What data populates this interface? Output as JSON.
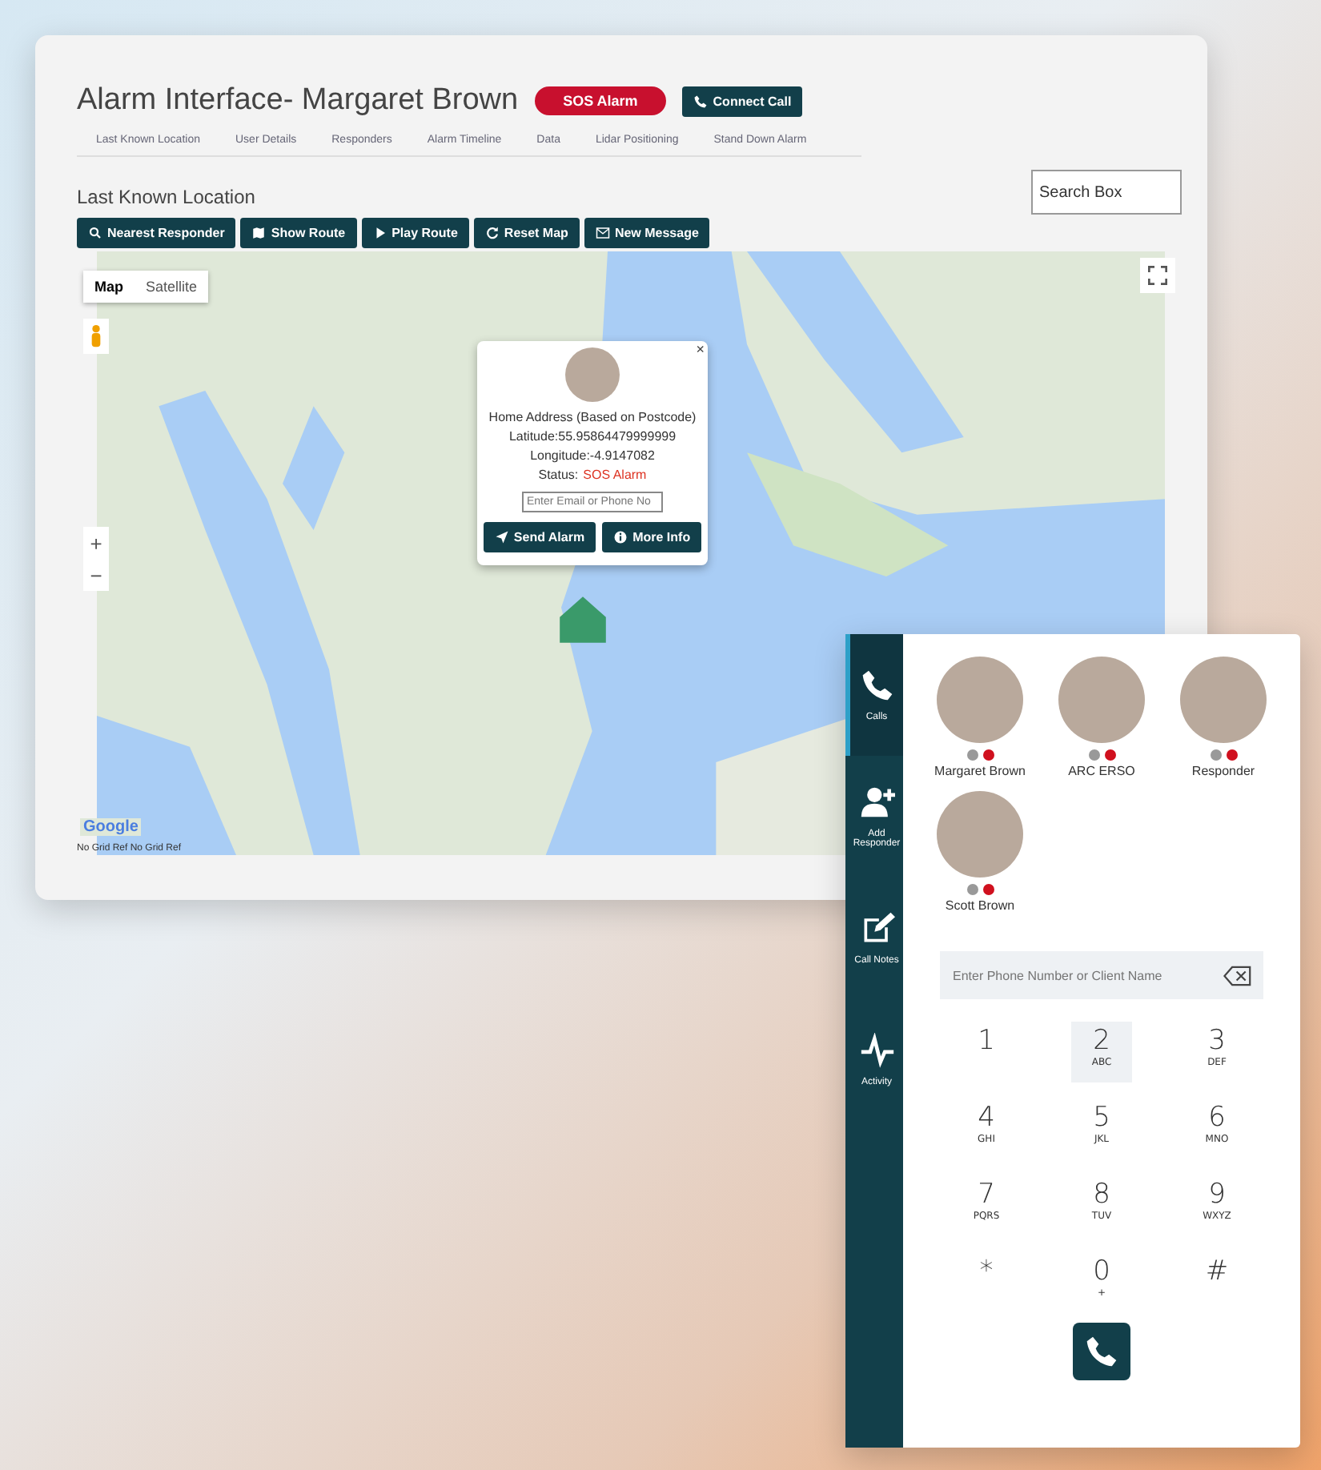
{
  "alarm_window": {
    "title": "Alarm Interface- Margaret Brown",
    "status_badge": "SOS Alarm",
    "connect_button": "Connect Call",
    "tabs": [
      {
        "label": "Last Known Location"
      },
      {
        "label": "User Details"
      },
      {
        "label": "Responders"
      },
      {
        "label": "Alarm Timeline"
      },
      {
        "label": "Data"
      },
      {
        "label": "Lidar Positioning"
      },
      {
        "label": "Stand Down Alarm"
      }
    ],
    "section_title": "Last Known Location",
    "search": {
      "placeholder": "Search Box"
    },
    "toolbar": [
      {
        "label": "Nearest Responder",
        "kind": "search"
      },
      {
        "label": "Show Route",
        "kind": "map"
      },
      {
        "label": "Play Route",
        "kind": "play"
      },
      {
        "label": "Reset Map",
        "kind": "refresh"
      },
      {
        "label": "New Message",
        "kind": "message"
      }
    ],
    "map": {
      "map_types": [
        {
          "label": "Map",
          "selected": true
        },
        {
          "label": "Satellite",
          "selected": false
        }
      ],
      "zoom_in": "+",
      "zoom_out": "−",
      "popup": {
        "close": "×",
        "address": "Home Address (Based on Postcode)",
        "latitude": "Latitude:55.95864479999999",
        "longitude": "Longitude:-4.9147082",
        "status_label": "Status:",
        "status_value": "SOS Alarm",
        "contact": {
          "placeholder": "Enter Email or Phone No"
        },
        "buttons": [
          {
            "label": "Send Alarm",
            "kind": "send"
          },
          {
            "label": "More Info",
            "kind": "info"
          }
        ]
      },
      "attribution": "Google",
      "grid_ref": "No Grid Ref No Grid Ref"
    }
  },
  "dialer": {
    "nav": [
      {
        "label": "Calls",
        "kind": "phone",
        "selected": true
      },
      {
        "label": "Add Responder",
        "kind": "add-person",
        "selected": false
      },
      {
        "label": "Call Notes",
        "kind": "edit",
        "selected": false
      },
      {
        "label": "Activity",
        "kind": "pulse",
        "selected": false
      }
    ],
    "contacts": [
      {
        "name": "Margaret Brown"
      },
      {
        "name": "ARC ERSO"
      },
      {
        "name": "Responder"
      },
      {
        "name": "Scott Brown"
      }
    ],
    "phone_field": {
      "placeholder": "Enter Phone Number or Client Name"
    },
    "keypad": [
      {
        "digit": "1",
        "selected": false
      },
      {
        "digit": "2",
        "letters": "ABC",
        "selected": true
      },
      {
        "digit": "3",
        "letters": "DEF",
        "selected": false
      },
      {
        "digit": "4",
        "letters": "GHI",
        "selected": false
      },
      {
        "digit": "5",
        "letters": "JKL",
        "selected": false
      },
      {
        "digit": "6",
        "letters": "MNO",
        "selected": false
      },
      {
        "digit": "7",
        "letters": "PQRS",
        "selected": false
      },
      {
        "digit": "8",
        "letters": "TUV",
        "selected": false
      },
      {
        "digit": "9",
        "letters": "WXYZ",
        "selected": false
      },
      {
        "digit": "*",
        "selected": false
      },
      {
        "digit": "0",
        "letters": "+",
        "selected": false
      },
      {
        "digit": "#",
        "selected": false
      }
    ]
  }
}
